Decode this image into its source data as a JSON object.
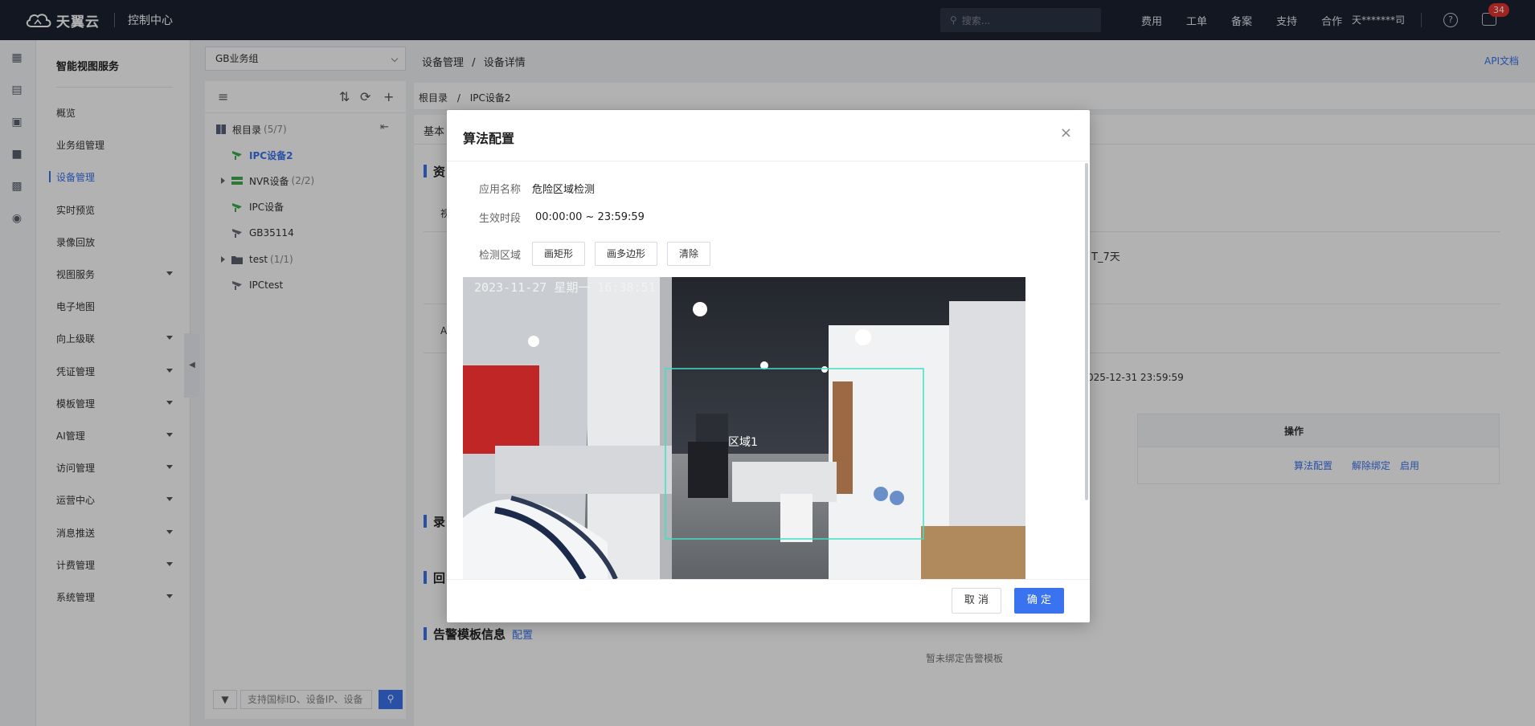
{
  "topbar": {
    "brand": "天翼云",
    "console": "控制中心",
    "search_placeholder": "搜索...",
    "nav": [
      "费用",
      "工单",
      "备案",
      "支持",
      "合作"
    ],
    "user": "天*******司",
    "help_glyph": "?",
    "message_count": "34"
  },
  "service_nav": {
    "title": "智能视图服务",
    "items": [
      {
        "label": "概览",
        "expandable": false
      },
      {
        "label": "业务组管理",
        "expandable": false
      },
      {
        "label": "设备管理",
        "expandable": false,
        "active": true
      },
      {
        "label": "实时预览",
        "expandable": false
      },
      {
        "label": "录像回放",
        "expandable": false
      },
      {
        "label": "视图服务",
        "expandable": true
      },
      {
        "label": "电子地图",
        "expandable": false
      },
      {
        "label": "向上级联",
        "expandable": true
      },
      {
        "label": "凭证管理",
        "expandable": true
      },
      {
        "label": "模板管理",
        "expandable": true
      },
      {
        "label": "AI管理",
        "expandable": true
      },
      {
        "label": "访问管理",
        "expandable": true
      },
      {
        "label": "运营中心",
        "expandable": true
      },
      {
        "label": "消息推送",
        "expandable": true
      },
      {
        "label": "计费管理",
        "expandable": true
      },
      {
        "label": "系统管理",
        "expandable": true
      }
    ]
  },
  "tree": {
    "group_select": "GB业务组",
    "root_label": "根目录",
    "root_count": "(5/7)",
    "nodes": [
      {
        "label": "IPC设备2",
        "count": "",
        "type": "camera-online",
        "selected": true,
        "expandable": false
      },
      {
        "label": "NVR设备",
        "count": "(2/2)",
        "type": "nvr",
        "selected": false,
        "expandable": true
      },
      {
        "label": "IPC设备",
        "count": "",
        "type": "camera-online",
        "selected": false,
        "expandable": false
      },
      {
        "label": "GB35114",
        "count": "",
        "type": "camera-offline",
        "selected": false,
        "expandable": false
      },
      {
        "label": "test",
        "count": "(1/1)",
        "type": "folder",
        "selected": false,
        "expandable": true
      },
      {
        "label": "IPCtest",
        "count": "",
        "type": "camera-offline",
        "selected": false,
        "expandable": false
      }
    ],
    "search_placeholder": "支持国标ID、设备IP、设备"
  },
  "main": {
    "breadcrumb_parent": "设备管理",
    "breadcrumb_sep": "/",
    "breadcrumb_current": "设备详情",
    "api_doc": "API文档",
    "sub_crumb_root": "根目录",
    "sub_crumb_current": "IPC设备2",
    "tab_basic": "基本",
    "sec_resource": "资",
    "label_shi": "视",
    "text_plan": "T_7天",
    "label_a": "A",
    "text_expire": "025-12-31 23:59:59",
    "col_ops": "操作",
    "op_algo": "算法配置",
    "op_unbind": "解除绑定",
    "op_enable": "启用",
    "sec_record": "录",
    "sec_playback": "回",
    "sec_alarm": "告警模板信息",
    "alarm_config": "配置",
    "alarm_empty": "暂未绑定告警模板"
  },
  "modal": {
    "title": "算法配置",
    "close_glyph": "×",
    "app_name_label": "应用名称",
    "app_name_value": "危险区域检测",
    "time_label": "生效时段",
    "time_value": "00:00:00 ~ 23:59:59",
    "region_label": "检测区域",
    "btn_rect": "画矩形",
    "btn_polygon": "画多边形",
    "btn_clear": "清除",
    "video_timestamp": "2023-11-27 星期一 16:38:51",
    "video_region_label": "区域1",
    "cancel": "取 消",
    "ok": "确 定"
  },
  "colors": {
    "accent": "#3a73f0",
    "topbar": "#1c2232",
    "region_box": "#3fe0c5",
    "badge": "#e5342f",
    "online": "#3fae4f"
  }
}
